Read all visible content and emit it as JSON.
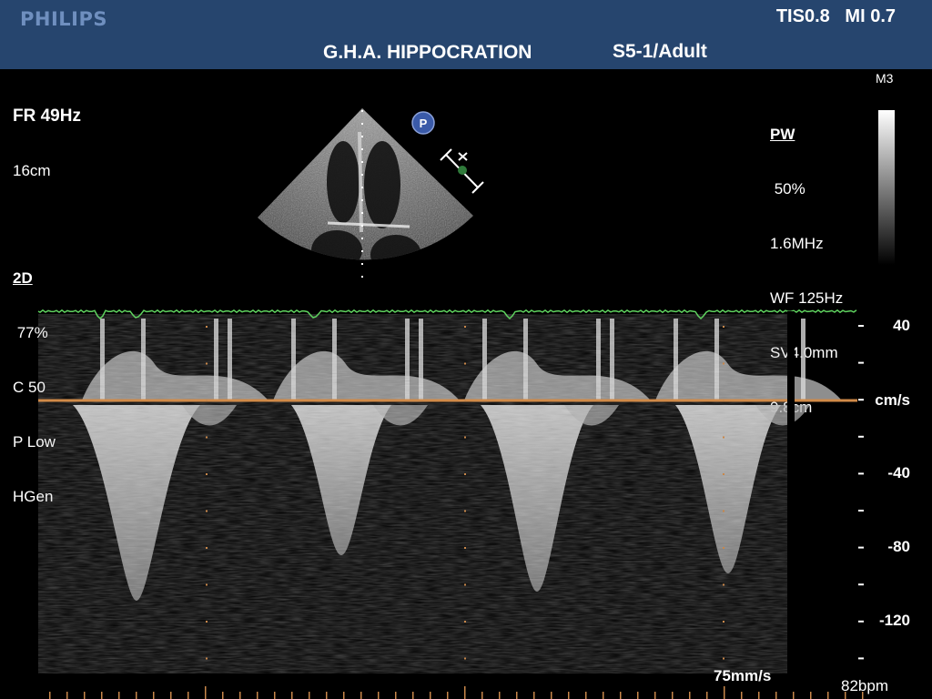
{
  "header": {
    "brand": "PHILIPS",
    "tis": "TIS0.8",
    "mi": "MI 0.7",
    "hospital": "G.H.A. HIPPOCRATION",
    "probe": "S5-1/Adult"
  },
  "left_params": {
    "frame_rate": "FR 49Hz",
    "depth": "16cm",
    "mode": "2D",
    "gain": " 77%",
    "compression": "C 50",
    "power": "P Low",
    "harmonic": "HGen"
  },
  "right_params": {
    "mode": "PW",
    "gain": " 50%",
    "frequency": "1.6MHz",
    "wall_filter": "WF 125Hz",
    "sample_volume": "SV4.0mm",
    "gate_depth": "9.8cm",
    "map": "M3"
  },
  "pw_marker": "P",
  "velocity_scale": {
    "unit": "cm/s",
    "labels": [
      "40",
      "-40",
      "-80",
      "-120"
    ],
    "values": [
      40,
      -40,
      -80,
      -120
    ]
  },
  "footer": {
    "sweep_speed": "75mm/s",
    "heart_rate": "82bpm"
  },
  "colors": {
    "header_bg": "#26456e",
    "baseline": "#d08a48",
    "ecg": "#5fd35f",
    "tick": "#c8874a"
  },
  "icons": [
    "pw-indicator-icon",
    "sample-gate-icon"
  ]
}
